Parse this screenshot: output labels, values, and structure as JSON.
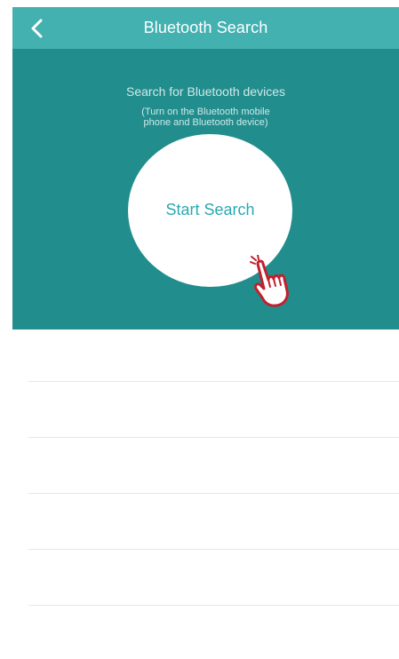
{
  "navbar": {
    "title": "Bluetooth Search",
    "back_icon": "chevron-left-icon"
  },
  "hero": {
    "title": "Search for Bluetooth devices",
    "subtitle_line1": "(Turn on the Bluetooth mobile",
    "subtitle_line2": "phone and Bluetooth device)",
    "button_label": "Start Search",
    "hand_icon": "pointing-hand-icon"
  },
  "device_list": {
    "items": [
      "",
      "",
      "",
      "",
      ""
    ]
  },
  "colors": {
    "navbar": "#44b1b1",
    "hero": "#228d8d",
    "button_text": "#2aa9b2",
    "hand": "#c0212e"
  }
}
